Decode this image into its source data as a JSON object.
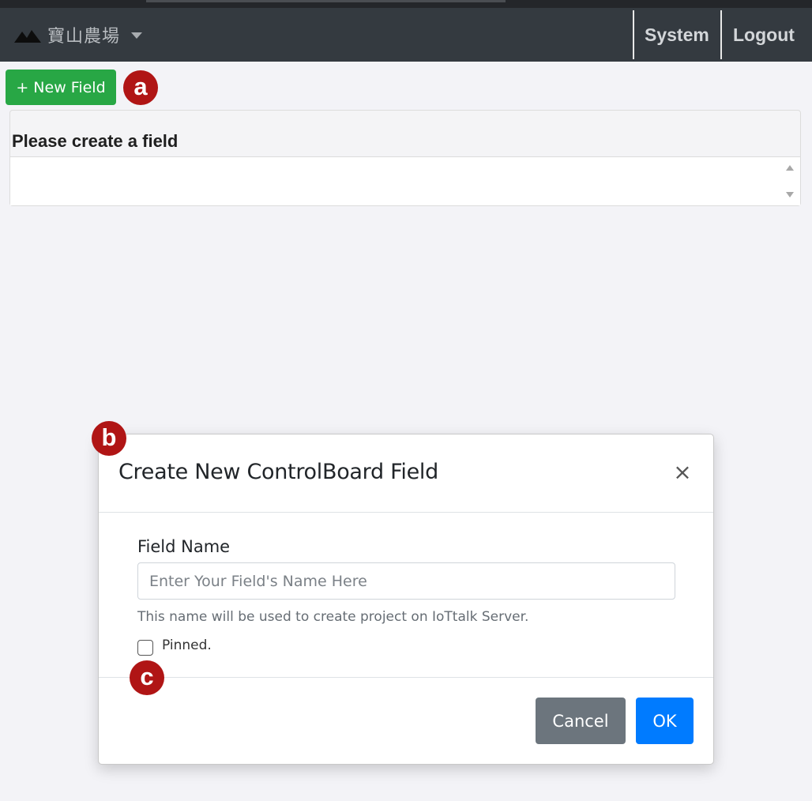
{
  "navbar": {
    "brand_name": "寶山農場",
    "brand_icon": "mountain-icon",
    "dropdown_icon": "caret-down-icon",
    "links": [
      "System",
      "Logout"
    ]
  },
  "toolbar": {
    "new_field_label": "+ New Field"
  },
  "field_panel": {
    "title": "Please create a field"
  },
  "callouts": {
    "a": "a",
    "b": "b",
    "c": "c"
  },
  "modal": {
    "title": "Create New ControlBoard Field",
    "close_label": "×",
    "field_label": "Field Name",
    "field_value": "",
    "field_placeholder": "Enter Your Field's Name Here",
    "help_text": "This name will be used to create project on IoTtalk Server.",
    "pinned_label": "Pinned.",
    "pinned_checked": false,
    "cancel_label": "Cancel",
    "ok_label": "OK"
  },
  "colors": {
    "navbar_bg": "#343a40",
    "success": "#28a745",
    "secondary": "#6c757d",
    "primary": "#007bff",
    "callout": "#b01515"
  }
}
